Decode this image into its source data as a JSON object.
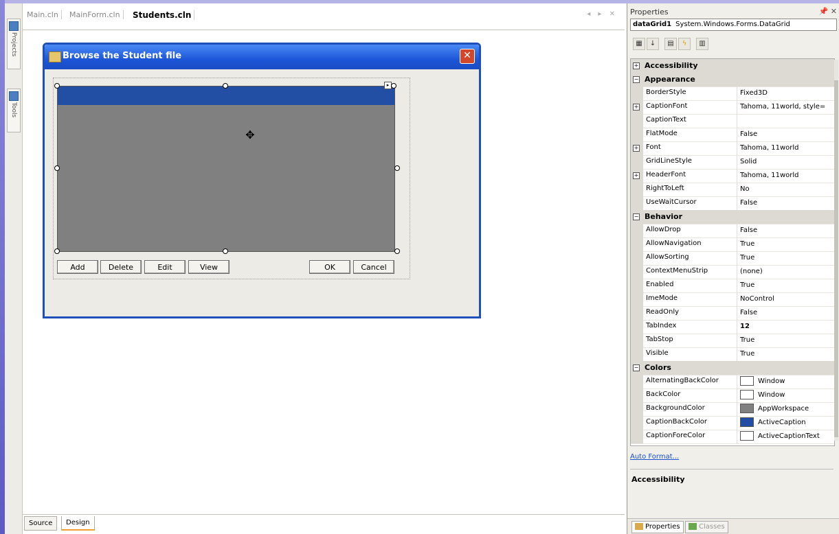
{
  "left_toolstrip": {
    "items": [
      {
        "label": "Projects",
        "icon": "projects-icon"
      },
      {
        "label": "Tools",
        "icon": "toolbox-icon"
      }
    ]
  },
  "document_tabs": {
    "tabs": [
      "Main.cln",
      "MainForm.cln",
      "Students.cln"
    ],
    "active": "Students.cln",
    "nav": "◂ ▸ ✕"
  },
  "view_tabs": {
    "source": "Source",
    "design": "Design"
  },
  "form": {
    "title": "Browse the Student file",
    "close_glyph": "✕",
    "datagrid": {
      "caption_color": "#224fa4",
      "background_color": "#808080"
    },
    "buttons": {
      "add": "Add",
      "delete": "Delete",
      "edit": "Edit",
      "view": "View",
      "ok": "OK",
      "cancel": "Cancel"
    }
  },
  "properties": {
    "title": "Properties",
    "pin": "📌 ✕",
    "object_name": "dataGrid1",
    "object_type": "System.Windows.Forms.DataGrid",
    "toolbar": [
      "categorized-icon",
      "alphabetical-icon",
      "properties-icon",
      "events-icon",
      "property-pages-icon"
    ],
    "rows": [
      {
        "type": "cat",
        "name": "Accessibility",
        "expander": "+"
      },
      {
        "type": "cat",
        "name": "Appearance",
        "expander": "−"
      },
      {
        "type": "prop",
        "name": "BorderStyle",
        "value": "Fixed3D"
      },
      {
        "type": "prop",
        "name": "CaptionFont",
        "value": "Tahoma, 11world, style=",
        "expander": "+"
      },
      {
        "type": "prop",
        "name": "CaptionText",
        "value": ""
      },
      {
        "type": "prop",
        "name": "FlatMode",
        "value": "False"
      },
      {
        "type": "prop",
        "name": "Font",
        "value": "Tahoma, 11world",
        "expander": "+"
      },
      {
        "type": "prop",
        "name": "GridLineStyle",
        "value": "Solid"
      },
      {
        "type": "prop",
        "name": "HeaderFont",
        "value": "Tahoma, 11world",
        "expander": "+"
      },
      {
        "type": "prop",
        "name": "RightToLeft",
        "value": "No"
      },
      {
        "type": "prop",
        "name": "UseWaitCursor",
        "value": "False"
      },
      {
        "type": "cat",
        "name": "Behavior",
        "expander": "−"
      },
      {
        "type": "prop",
        "name": "AllowDrop",
        "value": "False"
      },
      {
        "type": "prop",
        "name": "AllowNavigation",
        "value": "True"
      },
      {
        "type": "prop",
        "name": "AllowSorting",
        "value": "True"
      },
      {
        "type": "prop",
        "name": "ContextMenuStrip",
        "value": "(none)"
      },
      {
        "type": "prop",
        "name": "Enabled",
        "value": "True"
      },
      {
        "type": "prop",
        "name": "ImeMode",
        "value": "NoControl"
      },
      {
        "type": "prop",
        "name": "ReadOnly",
        "value": "False"
      },
      {
        "type": "prop",
        "name": "TabIndex",
        "value": "12",
        "bold": true
      },
      {
        "type": "prop",
        "name": "TabStop",
        "value": "True"
      },
      {
        "type": "prop",
        "name": "Visible",
        "value": "True"
      },
      {
        "type": "cat",
        "name": "Colors",
        "expander": "−"
      },
      {
        "type": "prop",
        "name": "AlternatingBackColor",
        "value": "Window",
        "swatch": "#ffffff"
      },
      {
        "type": "prop",
        "name": "BackColor",
        "value": "Window",
        "swatch": "#ffffff"
      },
      {
        "type": "prop",
        "name": "BackgroundColor",
        "value": "AppWorkspace",
        "swatch": "#808080"
      },
      {
        "type": "prop",
        "name": "CaptionBackColor",
        "value": "ActiveCaption",
        "swatch": "#224fa4"
      },
      {
        "type": "prop",
        "name": "CaptionForeColor",
        "value": "ActiveCaptionText",
        "swatch": "#ffffff"
      }
    ],
    "auto_format": "Auto Format...",
    "description_title": "Accessibility",
    "bottom_tabs": [
      "Properties",
      "Classes"
    ]
  }
}
